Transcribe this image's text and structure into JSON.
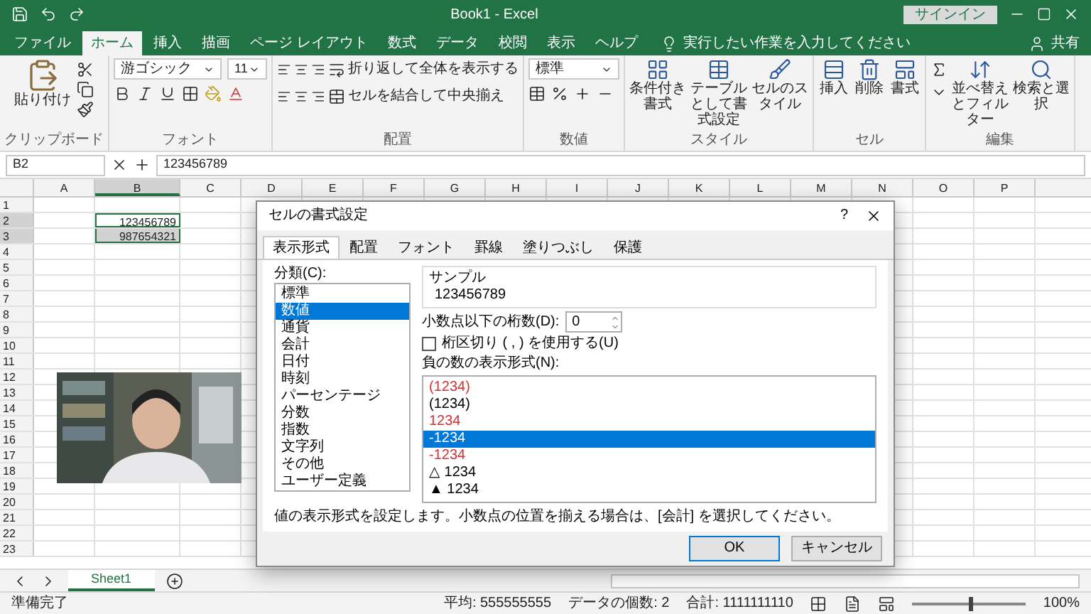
{
  "window": {
    "title": "Book1 - Excel",
    "signin": "サインイン"
  },
  "ribbon_tabs": [
    {
      "label": "ファイル",
      "selected": false
    },
    {
      "label": "ホーム",
      "selected": true
    },
    {
      "label": "挿入",
      "selected": false
    },
    {
      "label": "描画",
      "selected": false
    },
    {
      "label": "ページ レイアウト",
      "selected": false
    },
    {
      "label": "数式",
      "selected": false
    },
    {
      "label": "データ",
      "selected": false
    },
    {
      "label": "校閲",
      "selected": false
    },
    {
      "label": "表示",
      "selected": false
    },
    {
      "label": "ヘルプ",
      "selected": false
    }
  ],
  "tell_me": "実行したい作業を入力してください",
  "share": "共有",
  "ribbon_groups": [
    {
      "kind": "clipboard",
      "label": "クリップボード",
      "paste": "貼り付け"
    },
    {
      "kind": "font",
      "label": "フォント",
      "font_name": "游ゴシック",
      "font_size": "11"
    },
    {
      "kind": "alignment",
      "label": "配置",
      "wrap": "折り返して全体を表示する",
      "merge": "セルを結合して中央揃え"
    },
    {
      "kind": "number",
      "label": "数値",
      "format": "標準"
    },
    {
      "kind": "styles",
      "label": "スタイル",
      "buttons": [
        "条件付き書式",
        "テーブルとして書式設定",
        "セルのスタイル"
      ]
    },
    {
      "kind": "cells",
      "label": "セル",
      "buttons": [
        "挿入",
        "削除",
        "書式"
      ]
    },
    {
      "kind": "editing",
      "label": "編集",
      "buttons": [
        "並べ替えとフィルター",
        "検索と選択"
      ]
    }
  ],
  "formula_bar": {
    "name_box": "B2",
    "value": "123456789"
  },
  "sheet": {
    "columns": [
      {
        "label": "A",
        "selected": false
      },
      {
        "label": "B",
        "selected": true
      },
      {
        "label": "C",
        "selected": false
      },
      {
        "label": "D",
        "selected": false
      },
      {
        "label": "E",
        "selected": false
      },
      {
        "label": "F",
        "selected": false
      },
      {
        "label": "G",
        "selected": false
      },
      {
        "label": "H",
        "selected": false
      },
      {
        "label": "I",
        "selected": false
      },
      {
        "label": "J",
        "selected": false
      },
      {
        "label": "K",
        "selected": false
      },
      {
        "label": "L",
        "selected": false
      },
      {
        "label": "M",
        "selected": false
      },
      {
        "label": "N",
        "selected": false
      },
      {
        "label": "O",
        "selected": false
      },
      {
        "label": "P",
        "selected": false
      }
    ],
    "rows": [
      {
        "label": "1",
        "selected": false
      },
      {
        "label": "2",
        "selected": true,
        "cells": [
          null,
          {
            "text": "123456789",
            "active": true
          }
        ]
      },
      {
        "label": "3",
        "selected": true,
        "cells": [
          null,
          {
            "text": "987654321",
            "active": false
          }
        ]
      },
      {
        "label": "4",
        "selected": false
      },
      {
        "label": "5",
        "selected": false
      },
      {
        "label": "6",
        "selected": false
      },
      {
        "label": "7",
        "selected": false
      },
      {
        "label": "8",
        "selected": false
      },
      {
        "label": "9",
        "selected": false
      },
      {
        "label": "10",
        "selected": false
      },
      {
        "label": "11",
        "selected": false
      },
      {
        "label": "12",
        "selected": false
      },
      {
        "label": "13",
        "selected": false
      },
      {
        "label": "14",
        "selected": false
      },
      {
        "label": "15",
        "selected": false
      },
      {
        "label": "16",
        "selected": false
      },
      {
        "label": "17",
        "selected": false
      },
      {
        "label": "18",
        "selected": false
      },
      {
        "label": "19",
        "selected": false
      },
      {
        "label": "20",
        "selected": false
      },
      {
        "label": "21",
        "selected": false
      },
      {
        "label": "22",
        "selected": false
      },
      {
        "label": "23",
        "selected": false
      }
    ]
  },
  "sheet_tabs": [
    {
      "label": "Sheet1",
      "selected": true
    }
  ],
  "status_bar": {
    "ready": "準備完了",
    "average": "平均: 555555555",
    "count": "データの個数: 2",
    "sum": "合計: 1111111110",
    "zoom": "100%",
    "zoom_level": {
      "level": 0.5
    }
  },
  "dialog": {
    "title": "セルの書式設定",
    "help": "?",
    "tabs": [
      {
        "label": "表示形式",
        "selected": true
      },
      {
        "label": "配置",
        "selected": false
      },
      {
        "label": "フォント",
        "selected": false
      },
      {
        "label": "罫線",
        "selected": false
      },
      {
        "label": "塗りつぶし",
        "selected": false
      },
      {
        "label": "保護",
        "selected": false
      }
    ],
    "category_label": "分類(C):",
    "categories": [
      {
        "label": "標準",
        "selected": false
      },
      {
        "label": "数値",
        "selected": true
      },
      {
        "label": "通貨",
        "selected": false
      },
      {
        "label": "会計",
        "selected": false
      },
      {
        "label": "日付",
        "selected": false
      },
      {
        "label": "時刻",
        "selected": false
      },
      {
        "label": "パーセンテージ",
        "selected": false
      },
      {
        "label": "分数",
        "selected": false
      },
      {
        "label": "指数",
        "selected": false
      },
      {
        "label": "文字列",
        "selected": false
      },
      {
        "label": "その他",
        "selected": false
      },
      {
        "label": "ユーザー定義",
        "selected": false
      }
    ],
    "sample_label": "サンプル",
    "sample": "123456789",
    "decimals_label": "小数点以下の桁数(D):",
    "decimals": "0",
    "separator": {
      "label": "桁区切り ( , ) を使用する(U)",
      "checked": false
    },
    "negative_label": "負の数の表示形式(N):",
    "negative_formats": [
      {
        "label": "(1234)",
        "color": "#d13438",
        "selected": false
      },
      {
        "label": "(1234)",
        "color": "#000000",
        "selected": false
      },
      {
        "label": "1234",
        "color": "#d13438",
        "selected": false
      },
      {
        "label": "-1234",
        "selected": true
      },
      {
        "label": "-1234",
        "color": "#d13438",
        "selected": false
      },
      {
        "label": "△ 1234",
        "color": "#000000",
        "selected": false
      },
      {
        "label": "▲ 1234",
        "color": "#000000",
        "selected": false
      }
    ],
    "description": "値の表示形式を設定します。小数点の位置を揃える場合は、[会計] を選択してください。",
    "ok": "OK",
    "cancel": "キャンセル"
  }
}
